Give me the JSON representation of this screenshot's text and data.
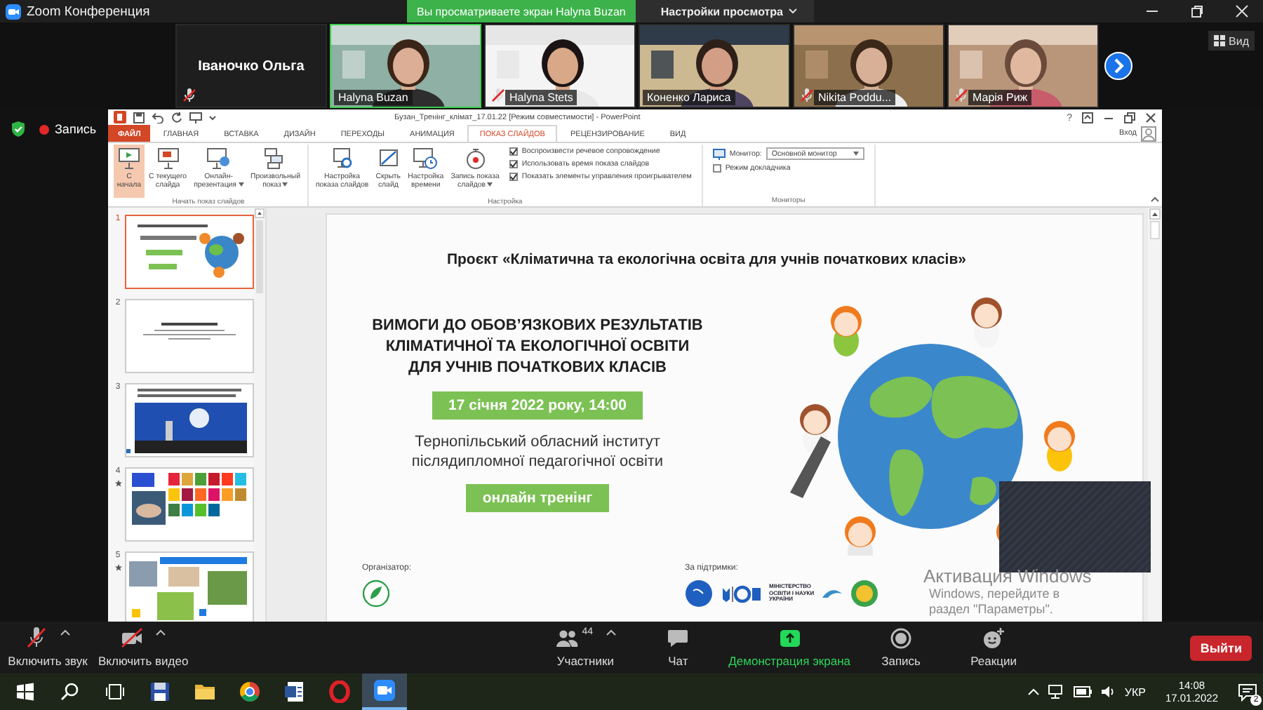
{
  "window": {
    "title": "Zoom Конференция"
  },
  "share_banner": {
    "text": "Вы просматриваете экран Halyna Buzan",
    "menu": "Настройки просмотра"
  },
  "participants": [
    {
      "name": "Іваночко Ольга",
      "kind": "name_only",
      "muted": true,
      "speaking": false
    },
    {
      "name": "Halyna Buzan",
      "kind": "video",
      "muted": false,
      "speaking": true
    },
    {
      "name": "Halyna Stets",
      "kind": "video",
      "muted": true,
      "speaking": false
    },
    {
      "name": "Коненко Лариса",
      "kind": "video",
      "muted": false,
      "speaking": false
    },
    {
      "name": "Nikita Poddu...",
      "kind": "video",
      "muted": true,
      "speaking": false
    },
    {
      "name": "Марія Риж",
      "kind": "video",
      "muted": true,
      "speaking": false
    }
  ],
  "view_button": "Вид",
  "recording": {
    "label": "Запись"
  },
  "powerpoint": {
    "title": "Бузан_Тренінг_клімат_17.01.22 [Режим совместимости] - PowerPoint",
    "help": "?",
    "sign_in": "Вход",
    "tabs": [
      {
        "label": "ФАЙЛ",
        "kind": "file",
        "selected": false
      },
      {
        "label": "ГЛАВНАЯ",
        "kind": "tab",
        "selected": false
      },
      {
        "label": "ВСТАВКА",
        "kind": "tab",
        "selected": false
      },
      {
        "label": "ДИЗАЙН",
        "kind": "tab",
        "selected": false
      },
      {
        "label": "ПЕРЕХОДЫ",
        "kind": "tab",
        "selected": false
      },
      {
        "label": "АНИМАЦИЯ",
        "kind": "tab",
        "selected": false
      },
      {
        "label": "ПОКАЗ СЛАЙДОВ",
        "kind": "tab",
        "selected": true
      },
      {
        "label": "РЕЦЕНЗИРОВАНИЕ",
        "kind": "tab",
        "selected": false
      },
      {
        "label": "ВИД",
        "kind": "tab",
        "selected": false
      }
    ],
    "ribbon": [
      {
        "label": "Начать показ слайдов",
        "buttons": [
          {
            "label": "С\nначала",
            "kind": "from_start",
            "selected": true,
            "dropdown": false
          },
          {
            "label": "С текущего\nслайда",
            "kind": "from_current",
            "selected": false,
            "dropdown": false
          },
          {
            "label": "Онлайн-\nпрезентация",
            "kind": "online",
            "selected": false,
            "dropdown": true
          },
          {
            "label": "Произвольный\nпоказ",
            "kind": "custom",
            "selected": false,
            "dropdown": true
          }
        ]
      },
      {
        "label": "Настройка",
        "buttons": [
          {
            "label": "Настройка\nпоказа слайдов",
            "kind": "setup",
            "selected": false,
            "dropdown": false
          },
          {
            "label": "Скрыть\nслайд",
            "kind": "hide",
            "selected": false,
            "dropdown": false
          },
          {
            "label": "Настройка\nвремени",
            "kind": "timing",
            "selected": false,
            "dropdown": false
          },
          {
            "label": "Запись показа\nслайдов",
            "kind": "record",
            "selected": false,
            "dropdown": true
          }
        ],
        "checkboxes": [
          {
            "label": "Воспроизвести речевое сопровождение",
            "checked": true
          },
          {
            "label": "Использовать время показа слайдов",
            "checked": true
          },
          {
            "label": "Показать элементы управления проигрывателем",
            "checked": true
          }
        ]
      },
      {
        "label": "Мониторы",
        "monitor_label": "Монитор:",
        "monitor_value": "Основной монитор",
        "checkboxes": [
          {
            "label": "Режим докладчика",
            "checked": false
          }
        ]
      }
    ]
  },
  "slides": [
    {
      "number": "1",
      "selected": true,
      "transition": false
    },
    {
      "number": "2",
      "selected": false,
      "transition": false
    },
    {
      "number": "3",
      "selected": false,
      "transition": false
    },
    {
      "number": "4",
      "selected": false,
      "transition": true
    },
    {
      "number": "5",
      "selected": false,
      "transition": true
    }
  ],
  "slide": {
    "project": "Проєкт «Кліматична та екологічна освіта для учнів початкових класів»",
    "heading": "ВИМОГИ ДО ОБОВ’ЯЗКОВИХ РЕЗУЛЬТАТІВ\nКЛІМАТИЧНОЇ ТА ЕКОЛОГІЧНОЇ ОСВІТИ\nДЛЯ УЧНІВ ПОЧАТКОВИХ КЛАСІВ",
    "date": "17 січня 2022 року, 14:00",
    "institute": "Тернопільський обласний інститут\nпіслядипломної педагогічної освіти",
    "format": "онлайн тренінг",
    "organizer_label": "Організатор:",
    "support_label": "За підтримки:",
    "ministry": "МІНІСТЕРСТВО\nОСВІТИ І НАУКИ\nУКРАЇНИ"
  },
  "activation_notice": {
    "title": "Активация Windows",
    "text": "Windows, перейдите в\nраздел \"Параметры\"."
  },
  "toolbar": {
    "items": [
      {
        "kind": "mic",
        "label": "Включить звук",
        "off": true,
        "caret": true
      },
      {
        "kind": "video",
        "label": "Включить видео",
        "off": true,
        "caret": true
      },
      {
        "kind": "participants",
        "label": "Участники",
        "count": "44",
        "caret": true
      },
      {
        "kind": "chat",
        "label": "Чат",
        "caret": false
      },
      {
        "kind": "share",
        "label": "Демонстрация экрана",
        "active": true,
        "caret": false
      },
      {
        "kind": "record",
        "label": "Запись",
        "caret": false
      },
      {
        "kind": "reactions",
        "label": "Реакции",
        "caret": false
      }
    ],
    "leave": "Выйти"
  },
  "taskbar": {
    "apps": [
      {
        "kind": "start",
        "active": false
      },
      {
        "kind": "search",
        "active": false
      },
      {
        "kind": "taskview",
        "active": false
      },
      {
        "kind": "disk",
        "active": false
      },
      {
        "kind": "folder",
        "active": false
      },
      {
        "kind": "browser",
        "active": false
      },
      {
        "kind": "document",
        "active": false
      },
      {
        "kind": "ring",
        "active": false
      },
      {
        "kind": "camera",
        "active": true
      }
    ],
    "language": "УКР",
    "time": "14:08",
    "date": "17.01.2022",
    "notifications": "2"
  }
}
